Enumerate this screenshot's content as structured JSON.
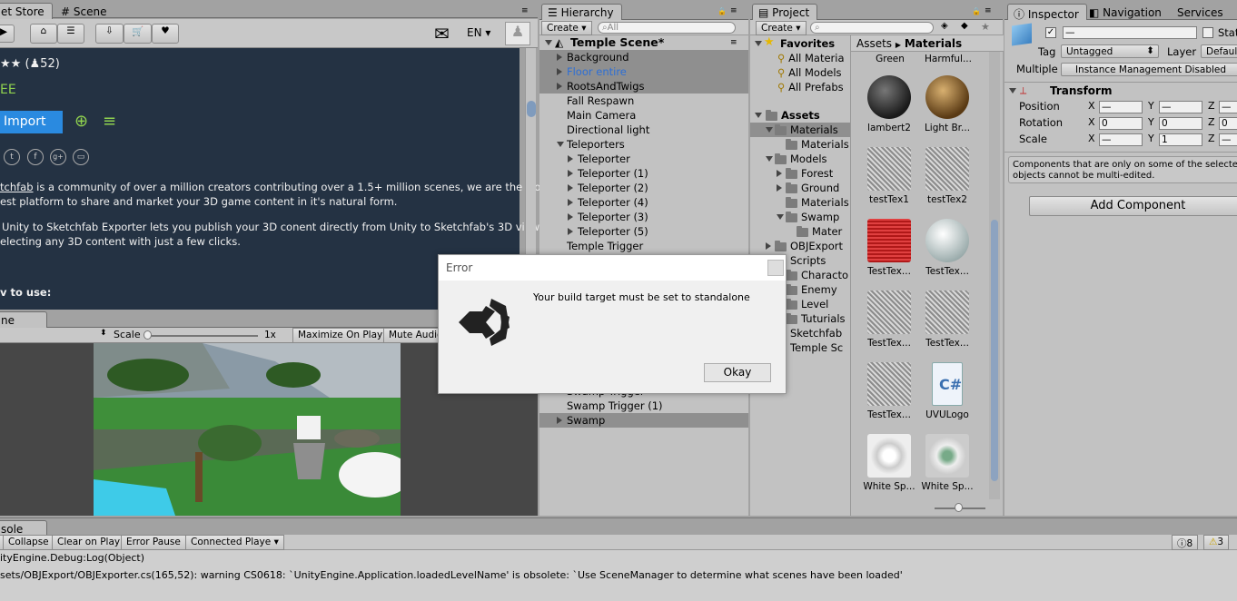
{
  "asset_store": {
    "tab_asset_store": "et Store",
    "tab_scene": "Scene",
    "lang": "EN",
    "rating_stars": "★★",
    "rating_count": "(♟52)",
    "price": "EE",
    "import_label": "Import",
    "desc_brand": "tchfab",
    "desc1": " is a community of over a million creators contributing over a 1.5+ million scenes, we are the world's",
    "desc2": "est platform to share and market your 3D game content in it's natural form.",
    "desc3": "Unity to Sketchfab Exporter lets you publish your 3D conent directly from Unity to Sketchfab's 3D viewer",
    "desc4": "electing any 3D content with just a few clicks.",
    "howto": "v to use:"
  },
  "game": {
    "tab": "ne",
    "scale_label": "Scale",
    "scale_value": "1x",
    "maximize": "Maximize On Play",
    "mute": "Mute Audio"
  },
  "hierarchy": {
    "tab": "Hierarchy",
    "create": "Create",
    "search_placeholder": "All",
    "scene": "Temple Scene*",
    "items": [
      {
        "label": "Background",
        "indent": 1,
        "arrow": "right",
        "sel": true
      },
      {
        "label": "Floor entire",
        "indent": 1,
        "arrow": "right",
        "sel": true,
        "blue": true
      },
      {
        "label": "RootsAndTwigs",
        "indent": 1,
        "arrow": "right",
        "sel": true
      },
      {
        "label": "Fall Respawn",
        "indent": 1,
        "arrow": ""
      },
      {
        "label": "Main Camera",
        "indent": 1,
        "arrow": ""
      },
      {
        "label": "Directional light",
        "indent": 1,
        "arrow": ""
      },
      {
        "label": "Teleporters",
        "indent": 1,
        "arrow": "down"
      },
      {
        "label": "Teleporter",
        "indent": 2,
        "arrow": "right"
      },
      {
        "label": "Teleporter (1)",
        "indent": 2,
        "arrow": "right"
      },
      {
        "label": "Teleporter (2)",
        "indent": 2,
        "arrow": "right"
      },
      {
        "label": "Teleporter (4)",
        "indent": 2,
        "arrow": "right"
      },
      {
        "label": "Teleporter (3)",
        "indent": 2,
        "arrow": "right"
      },
      {
        "label": "Teleporter (5)",
        "indent": 2,
        "arrow": "right"
      },
      {
        "label": "Temple Trigger",
        "indent": 1,
        "arrow": ""
      }
    ],
    "bottom_items": [
      {
        "label": "Swamp Trigger",
        "indent": 1,
        "arrow": ""
      },
      {
        "label": "Swamp Trigger (1)",
        "indent": 1,
        "arrow": ""
      },
      {
        "label": "Swamp",
        "indent": 1,
        "arrow": "right",
        "sel": true
      }
    ]
  },
  "project": {
    "tab": "Project",
    "create": "Create",
    "favorites": "Favorites",
    "fav_items": [
      "All Materia",
      "All Models",
      "All Prefabs"
    ],
    "assets": "Assets",
    "tree": [
      {
        "label": "Materials",
        "indent": 1,
        "arrow": "down",
        "sel": true
      },
      {
        "label": "Materials",
        "indent": 2,
        "arrow": ""
      },
      {
        "label": "Models",
        "indent": 1,
        "arrow": "down"
      },
      {
        "label": "Forest",
        "indent": 2,
        "arrow": "right"
      },
      {
        "label": "Ground",
        "indent": 2,
        "arrow": "right"
      },
      {
        "label": "Materials",
        "indent": 2,
        "arrow": ""
      },
      {
        "label": "Swamp",
        "indent": 2,
        "arrow": "down"
      },
      {
        "label": "Mater",
        "indent": 3,
        "arrow": ""
      },
      {
        "label": "OBJExport",
        "indent": 1,
        "arrow": "right"
      },
      {
        "label": "Scripts",
        "indent": 1,
        "arrow": ""
      },
      {
        "label": "Characto",
        "indent": 2,
        "arrow": ""
      },
      {
        "label": "Enemy",
        "indent": 2,
        "arrow": ""
      },
      {
        "label": "Level",
        "indent": 2,
        "arrow": ""
      },
      {
        "label": "Tuturials",
        "indent": 2,
        "arrow": ""
      },
      {
        "label": "Sketchfab",
        "indent": 1,
        "arrow": ""
      },
      {
        "label": "Temple Sc",
        "indent": 1,
        "arrow": ""
      }
    ],
    "breadcrumb_root": "Assets",
    "breadcrumb_current": "Materials",
    "top_labels": [
      "Green",
      "Harmful..."
    ],
    "grid": [
      {
        "label": "lambert2",
        "kind": "dark"
      },
      {
        "label": "Light Br...",
        "kind": "brown"
      },
      {
        "label": "testTex1",
        "kind": "hatch"
      },
      {
        "label": "testTex2",
        "kind": "hatch"
      },
      {
        "label": "TestTex...",
        "kind": "red"
      },
      {
        "label": "TestTex...",
        "kind": "white"
      },
      {
        "label": "TestTex...",
        "kind": "hatch"
      },
      {
        "label": "TestTex...",
        "kind": "hatch"
      },
      {
        "label": "TestTex...",
        "kind": "hatch"
      },
      {
        "label": "UVULogo",
        "kind": "cs"
      },
      {
        "label": "White Sp...",
        "kind": "speck"
      },
      {
        "label": "White Sp...",
        "kind": "speck2"
      }
    ]
  },
  "inspector": {
    "tab": "Inspector",
    "tab_nav": "Navigation",
    "tab_services": "Services",
    "name_value": "—",
    "static_label": "Stat",
    "tag_label": "Tag",
    "tag_value": "Untagged",
    "layer_label": "Layer",
    "layer_value": "Default",
    "multiple_label": "Multiple",
    "multiple_value": "Instance Management Disabled",
    "transform": "Transform",
    "position": "Position",
    "rotation": "Rotation",
    "scale": "Scale",
    "pos": [
      "—",
      "—",
      "—"
    ],
    "rot": [
      "0",
      "0",
      "0"
    ],
    "scl": [
      "—",
      "1",
      "—"
    ],
    "note1": "Components that are only on some of the selected",
    "note2": "objects cannot be multi-edited.",
    "add_component": "Add Component"
  },
  "console": {
    "tab": "sole",
    "collapse": "Collapse",
    "clear_on_play": "Clear on Play",
    "error_pause": "Error Pause",
    "connected": "Connected Playe",
    "count_warn_a": "8",
    "count_warn_b": "3",
    "line1": "ityEngine.Debug:Log(Object)",
    "line2": "sets/OBJExport/OBJExporter.cs(165,52): warning CS0618: `UnityEngine.Application.loadedLevelName' is obsolete: `Use SceneManager to determine what scenes have been loaded'"
  },
  "dialog": {
    "title": "Error",
    "message": "Your build target must be set to standalone",
    "ok": "Okay"
  }
}
